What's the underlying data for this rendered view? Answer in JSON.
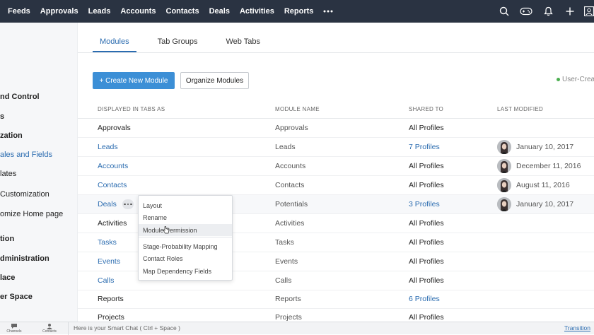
{
  "topnav": [
    "Feeds",
    "Approvals",
    "Leads",
    "Accounts",
    "Contacts",
    "Deals",
    "Activities",
    "Reports"
  ],
  "sidebar": [
    "nd Control",
    "s",
    "zation",
    "ales and Fields",
    "lates",
    "Customization",
    "omize Home page",
    "tion",
    "dministration",
    "lace",
    "er Space"
  ],
  "tabs": [
    "Modules",
    "Tab Groups",
    "Web Tabs"
  ],
  "buttons": {
    "create": "+  Create New Module",
    "organize": "Organize Modules"
  },
  "legend": "User-Creat",
  "columns": [
    "DISPLAYED IN TABS AS",
    "MODULE NAME",
    "SHARED TO",
    "LAST MODIFIED"
  ],
  "rows": [
    {
      "tab": "Approvals",
      "module": "Approvals",
      "shared": "All Profiles",
      "date": ""
    },
    {
      "tab": "Leads",
      "module": "Leads",
      "shared": "7 Profiles",
      "date": "January 10, 2017"
    },
    {
      "tab": "Accounts",
      "module": "Accounts",
      "shared": "All Profiles",
      "date": "December 11, 2016"
    },
    {
      "tab": "Contacts",
      "module": "Contacts",
      "shared": "All Profiles",
      "date": "August 11, 2016"
    },
    {
      "tab": "Deals",
      "module": "Potentials",
      "shared": "3 Profiles",
      "date": "January 10, 2017"
    },
    {
      "tab": "Activities",
      "module": "Activities",
      "shared": "All Profiles",
      "date": ""
    },
    {
      "tab": "Tasks",
      "module": "Tasks",
      "shared": "All Profiles",
      "date": ""
    },
    {
      "tab": "Events",
      "module": "Events",
      "shared": "All Profiles",
      "date": ""
    },
    {
      "tab": "Calls",
      "module": "Calls",
      "shared": "All Profiles",
      "date": ""
    },
    {
      "tab": "Reports",
      "module": "Reports",
      "shared": "6 Profiles",
      "date": ""
    },
    {
      "tab": "Projects",
      "module": "Projects",
      "shared": "All Profiles",
      "date": ""
    }
  ],
  "menu": [
    "Layout",
    "Rename",
    "Module Permission",
    "Stage-Probability Mapping",
    "Contact Roles",
    "Map Dependency Fields"
  ],
  "bottom": {
    "channels": "Channels",
    "contacts": "Contacts",
    "chat_placeholder": "Here is your Smart Chat ( Ctrl + Space )",
    "link": "Transition"
  },
  "colors": {
    "topbar": "#2a3342",
    "accent": "#2b6cb0",
    "primary_button": "#3c8fd6"
  },
  "icons": [
    "more-icon",
    "search-icon",
    "gamepad-icon",
    "bell-icon",
    "plus-icon",
    "user-icon",
    "avatar-photo",
    "chat-icon",
    "contacts-icon",
    "cursor-icon",
    "status-dot-icon"
  ]
}
